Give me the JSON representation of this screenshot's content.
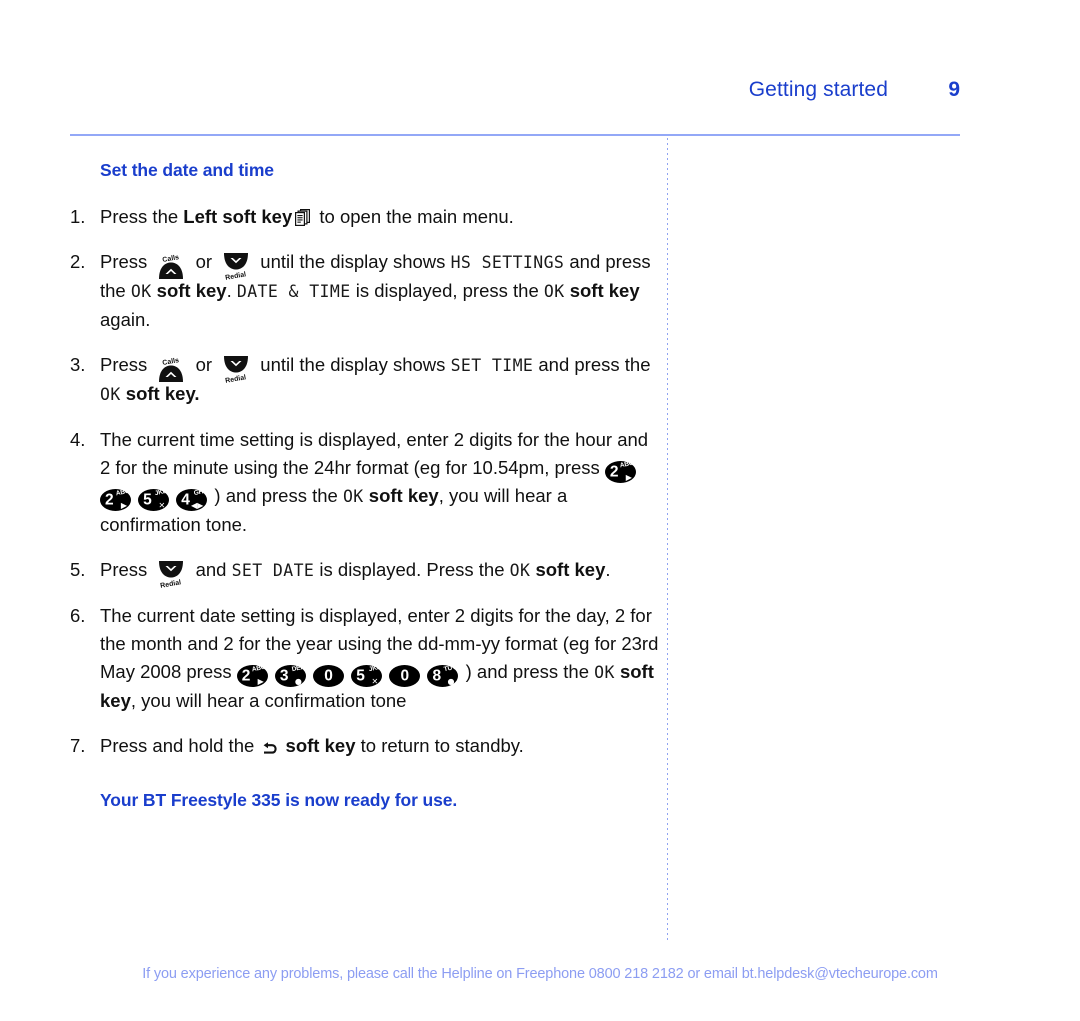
{
  "header": {
    "title": "Getting started",
    "page_number": "9",
    "rule_color": "#93a8f7"
  },
  "colors": {
    "heading_blue": "#1a3ecc",
    "footer_blue": "#8c9df2",
    "rule_blue": "#93a8f7",
    "key_black": "#000000"
  },
  "section": {
    "heading": "Set the date and time"
  },
  "steps": [
    {
      "num": "1.",
      "parts": [
        {
          "type": "text",
          "value": "Press the "
        },
        {
          "type": "bold",
          "value": "Left soft key"
        },
        {
          "type": "icon",
          "name": "left-soft-key-pages-icon"
        },
        {
          "type": "text",
          "value": " to open the main menu."
        }
      ]
    },
    {
      "num": "2.",
      "parts": [
        {
          "type": "text",
          "value": "Press "
        },
        {
          "type": "icon",
          "name": "nav-up-calls-key-icon",
          "label": "Calls"
        },
        {
          "type": "text",
          "value": " or "
        },
        {
          "type": "icon",
          "name": "nav-down-redial-key-icon",
          "label": "Redial"
        },
        {
          "type": "text",
          "value": " until the display shows "
        },
        {
          "type": "lcd",
          "value": "HS SETTINGS"
        },
        {
          "type": "text",
          "value": " and press the "
        },
        {
          "type": "lcd",
          "value": "OK"
        },
        {
          "type": "bold",
          "value": " soft key"
        },
        {
          "type": "text",
          "value": ". "
        },
        {
          "type": "lcd",
          "value": "DATE & TIME"
        },
        {
          "type": "text",
          "value": " is displayed, press the "
        },
        {
          "type": "lcd",
          "value": "OK"
        },
        {
          "type": "bold",
          "value": " soft key"
        },
        {
          "type": "text",
          "value": " again."
        }
      ]
    },
    {
      "num": "3.",
      "parts": [
        {
          "type": "text",
          "value": "Press "
        },
        {
          "type": "icon",
          "name": "nav-up-calls-key-icon",
          "label": "Calls"
        },
        {
          "type": "text",
          "value": " or "
        },
        {
          "type": "icon",
          "name": "nav-down-redial-key-icon",
          "label": "Redial"
        },
        {
          "type": "text",
          "value": " until the display shows "
        },
        {
          "type": "lcd",
          "value": "SET TIME"
        },
        {
          "type": "text",
          "value": " and press the "
        },
        {
          "type": "lcd",
          "value": "OK"
        },
        {
          "type": "bold",
          "value": " soft key."
        }
      ]
    },
    {
      "num": "4.",
      "parts": [
        {
          "type": "text",
          "value": "The current time setting is displayed, enter 2 digits for the hour and 2 for the minute using the 24hr format (eg for 10.54pm, press "
        },
        {
          "type": "keypad",
          "digit": "2",
          "letters": "ABC",
          "symbol": "▶"
        },
        {
          "type": "keypad",
          "digit": "2",
          "letters": "ABC",
          "symbol": "▶"
        },
        {
          "type": "keypad",
          "digit": "5",
          "letters": "JKL",
          "symbol": "✕"
        },
        {
          "type": "keypad",
          "digit": "4",
          "letters": "GHI",
          "symbol": "◀▶"
        },
        {
          "type": "text",
          "value": ") and press the "
        },
        {
          "type": "lcd",
          "value": "OK"
        },
        {
          "type": "bold",
          "value": " soft key"
        },
        {
          "type": "text",
          "value": ", you will hear a confirmation tone."
        }
      ]
    },
    {
      "num": "5.",
      "parts": [
        {
          "type": "text",
          "value": "Press "
        },
        {
          "type": "icon",
          "name": "nav-down-redial-key-icon",
          "label": "Redial"
        },
        {
          "type": "text",
          "value": " and "
        },
        {
          "type": "lcd",
          "value": "SET DATE"
        },
        {
          "type": "text",
          "value": " is displayed. Press the "
        },
        {
          "type": "lcd",
          "value": "OK"
        },
        {
          "type": "bold",
          "value": " soft key"
        },
        {
          "type": "text",
          "value": "."
        }
      ]
    },
    {
      "num": "6.",
      "parts": [
        {
          "type": "text",
          "value": "The current date setting is displayed, enter 2 digits for the day, 2 for the month and 2 for the year using the dd-mm-yy format (eg for 23rd May 2008 press "
        },
        {
          "type": "keypad",
          "digit": "2",
          "letters": "ABC",
          "symbol": "▶"
        },
        {
          "type": "keypad",
          "digit": "3",
          "letters": "DEF",
          "symbol": "●"
        },
        {
          "type": "keypad",
          "digit": "0",
          "letters": "",
          "symbol": ""
        },
        {
          "type": "keypad",
          "digit": "5",
          "letters": "JKL",
          "symbol": "✕"
        },
        {
          "type": "keypad",
          "digit": "0",
          "letters": "",
          "symbol": ""
        },
        {
          "type": "keypad",
          "digit": "8",
          "letters": "TUV",
          "symbol": "●"
        },
        {
          "type": "text",
          "value": ") and press the "
        },
        {
          "type": "lcd",
          "value": "OK"
        },
        {
          "type": "bold",
          "value": " soft key"
        },
        {
          "type": "text",
          "value": ", you will hear a confirmation tone"
        }
      ]
    },
    {
      "num": "7.",
      "parts": [
        {
          "type": "text",
          "value": "Press and hold the "
        },
        {
          "type": "icon",
          "name": "back-return-arrow-icon"
        },
        {
          "type": "bold",
          "value": " soft key"
        },
        {
          "type": "text",
          "value": " to return to standby."
        }
      ]
    }
  ],
  "callout": "Your BT Freestyle 335 is now ready for use.",
  "footer": "If you experience any problems, please call the Helpline on Freephone 0800 218 2182 or email bt.helpdesk@vtecheurope.com"
}
